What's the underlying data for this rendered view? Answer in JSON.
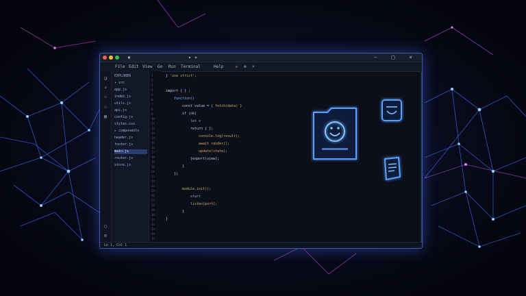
{
  "window": {
    "controls": "– □ ×",
    "menus": [
      "File",
      "Edit",
      "View",
      "Go",
      "Run",
      "Terminal",
      "Help"
    ],
    "toolbar": [
      "▷",
      "⚙",
      "⌕"
    ]
  },
  "activity_bar": {
    "icons": [
      "files-icon",
      "search-icon",
      "git-icon",
      "debug-icon",
      "extensions-icon",
      "account-icon",
      "settings-icon"
    ],
    "glyphs": [
      "❏",
      "⌕",
      "⑂",
      "⚇",
      "▦",
      "◯",
      "⚙"
    ]
  },
  "explorer": {
    "items": [
      {
        "label": "EXPLORER",
        "selected": false
      },
      {
        "label": "▾ src",
        "selected": false
      },
      {
        "label": "  app.js",
        "selected": false
      },
      {
        "label": "  index.js",
        "selected": false
      },
      {
        "label": "  utils.js",
        "selected": false
      },
      {
        "label": "  api.js",
        "selected": false
      },
      {
        "label": "  config.js",
        "selected": false
      },
      {
        "label": "  styles.css",
        "selected": false
      },
      {
        "label": "▸ components",
        "selected": false
      },
      {
        "label": "  header.js",
        "selected": false
      },
      {
        "label": "  footer.js",
        "selected": false
      },
      {
        "label": "  main.js",
        "selected": true
      },
      {
        "label": "  router.js",
        "selected": false
      },
      {
        "label": "  store.js",
        "selected": false
      }
    ]
  },
  "editor": {
    "line_numbers": [
      "1",
      "2",
      "3",
      "4",
      "5",
      "6",
      "7",
      "8",
      "9",
      "10",
      "11",
      "12",
      "13",
      "14",
      "15",
      "16",
      "17",
      "18",
      "19",
      "20",
      "21",
      "22",
      "23",
      "24",
      "25",
      "26",
      "27",
      "28",
      "29",
      "30",
      "31",
      "32",
      "33",
      "34",
      "35"
    ],
    "lines": [
      {
        "indent": 0,
        "text": "} ",
        "accent": "'use strict';",
        "color": "#c9b36a"
      },
      {
        "indent": 0,
        "text": "",
        "accent": "",
        "color": "#9aa6c0"
      },
      {
        "indent": 0,
        "text": "",
        "accent": "import { } ;",
        "color": "#c0cae0"
      },
      {
        "indent": 1,
        "text": "",
        "accent": "function()",
        "color": "#7fb0ff"
      },
      {
        "indent": 2,
        "text": "const value = ",
        "accent": "{ fetch(data) }",
        "color": "#d9a86a"
      },
      {
        "indent": 2,
        "text": "",
        "accent": "if (ok)",
        "color": "#c0cae0"
      },
      {
        "indent": 3,
        "text": "",
        "accent": "let x",
        "color": "#9aa6c0"
      },
      {
        "indent": 3,
        "text": "",
        "accent": "return { };",
        "color": "#c0cae0"
      },
      {
        "indent": 4,
        "text": "",
        "accent": "console.log(result);",
        "color": "#d9a86a"
      },
      {
        "indent": 4,
        "text": "",
        "accent": "await render();",
        "color": "#d9a86a"
      },
      {
        "indent": 4,
        "text": "",
        "accent": "update(state);",
        "color": "#d9a86a"
      },
      {
        "indent": 3,
        "text": "}",
        "accent": "export(view);",
        "color": "#c0cae0"
      },
      {
        "indent": 2,
        "text": "}",
        "accent": "",
        "color": "#c0cae0"
      },
      {
        "indent": 1,
        "text": "})",
        "accent": "",
        "color": "#c0cae0"
      },
      {
        "indent": 0,
        "text": "",
        "accent": "",
        "color": "#9aa6c0"
      },
      {
        "indent": 2,
        "text": "",
        "accent": "module.init();",
        "color": "#c9b36a"
      },
      {
        "indent": 3,
        "text": "",
        "accent": "start",
        "color": "#9aa6c0"
      },
      {
        "indent": 3,
        "text": "",
        "accent": "listen(port);",
        "color": "#d9a86a"
      },
      {
        "indent": 2,
        "text": "}",
        "accent": "",
        "color": "#c0cae0"
      },
      {
        "indent": 0,
        "text": "}",
        "accent": "",
        "color": "#c0cae0"
      }
    ]
  },
  "status": {
    "text": "Ln 1, Col 1"
  },
  "colors": {
    "accent": "#4f8dff",
    "glow": "#3a7bff"
  }
}
